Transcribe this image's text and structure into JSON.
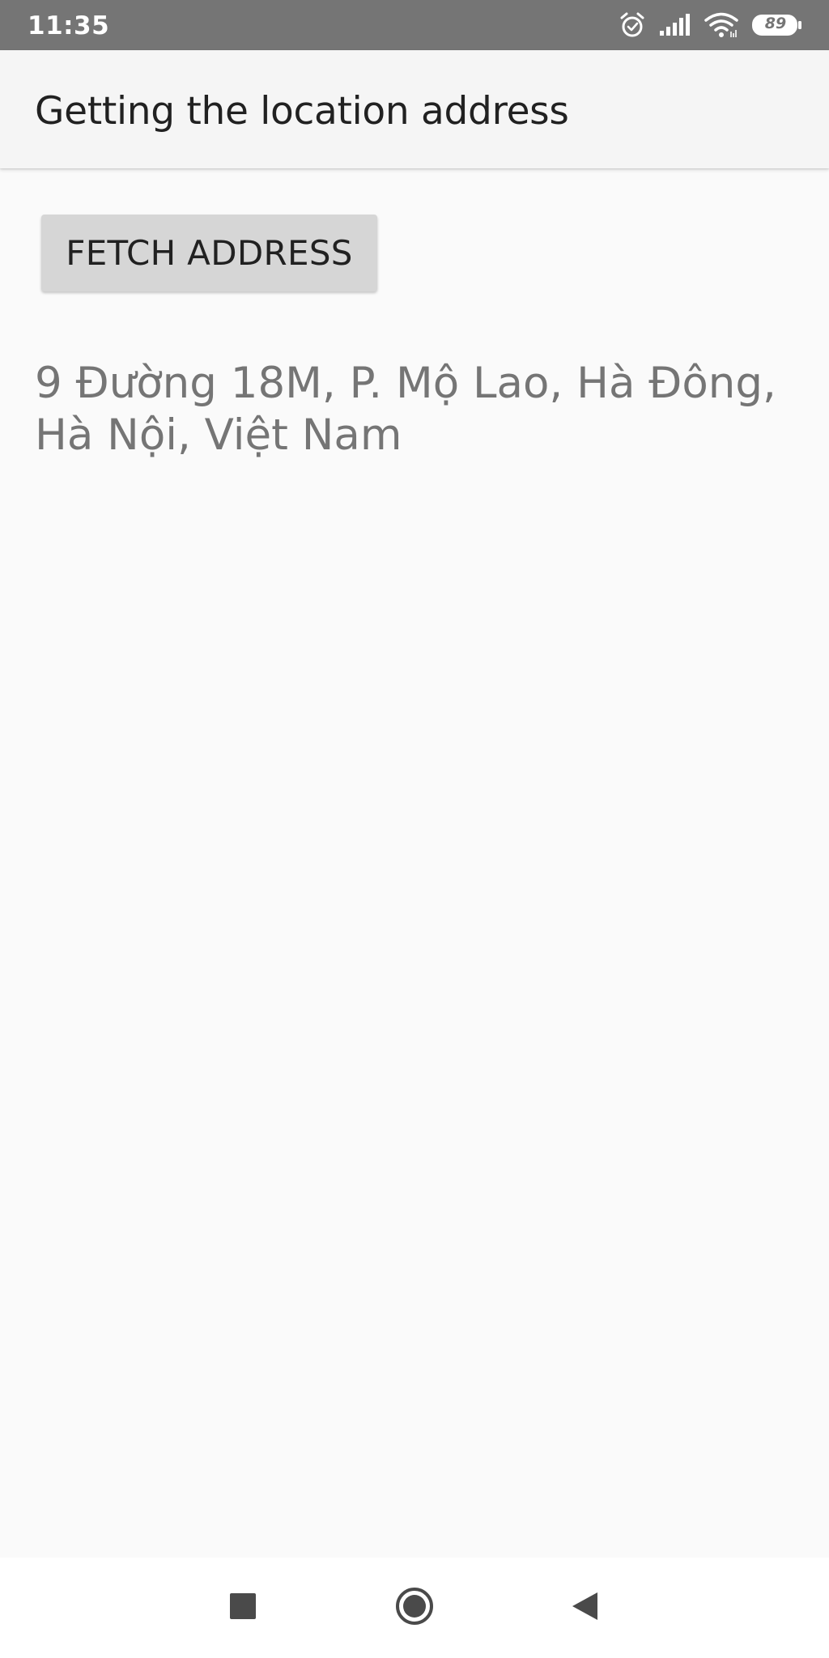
{
  "status_bar": {
    "time": "11:35",
    "icons": [
      "alarm-icon",
      "signal-icon",
      "wifi-icon",
      "battery-icon"
    ],
    "battery_level": "89"
  },
  "app_bar": {
    "title": "Getting the location address"
  },
  "main": {
    "fetch_button_label": "FETCH ADDRESS",
    "address": "9 Đường 18M, P. Mộ Lao, Hà Đông, Hà Nội, Việt Nam"
  },
  "nav_bar": {
    "buttons": [
      "recents-icon",
      "home-icon",
      "back-icon"
    ]
  },
  "colors": {
    "status_bar": "#757575",
    "app_bar": "#f5f5f5",
    "background": "#fafafa",
    "button": "#d6d6d6",
    "address_text": "#757575"
  }
}
